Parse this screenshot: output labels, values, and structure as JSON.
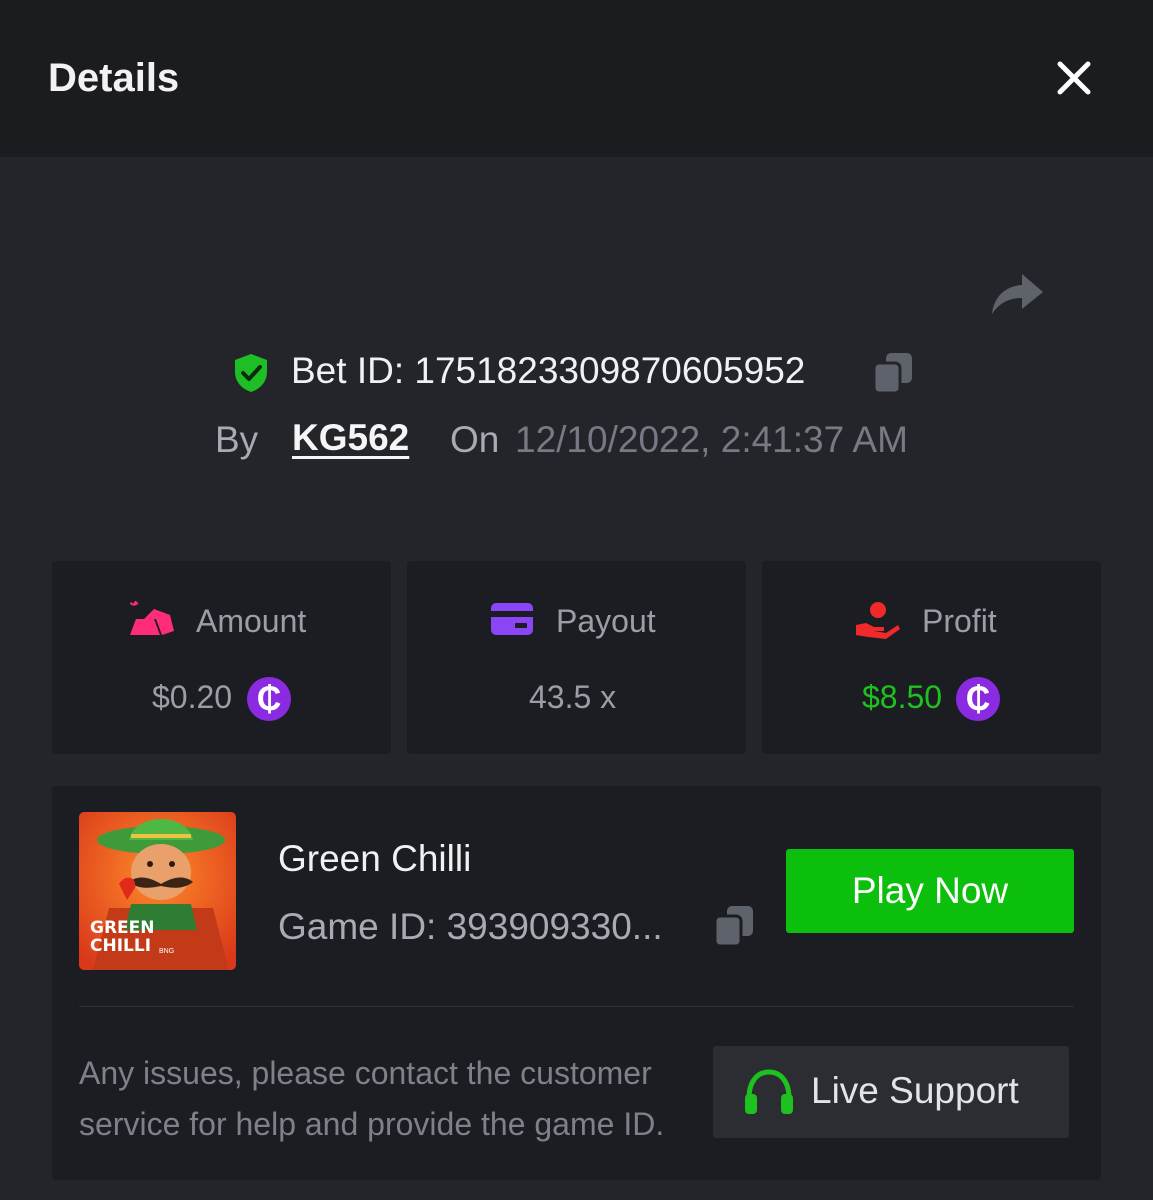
{
  "header": {
    "title": "Details"
  },
  "bet": {
    "id_label": "Bet ID: 1751823309870605952",
    "by_label": "By",
    "user": "KG562",
    "on_label": "On",
    "date": "12/10/2022, 2:41:37 AM"
  },
  "stats": {
    "amount": {
      "label": "Amount",
      "value": "$0.20",
      "coin_symbol": "₵"
    },
    "payout": {
      "label": "Payout",
      "value": "43.5 x"
    },
    "profit": {
      "label": "Profit",
      "value": "$8.50",
      "coin_symbol": "₵"
    }
  },
  "game": {
    "name": "Green Chilli",
    "id_label": "Game ID: 393909330...",
    "thumb_title_line1": "GREEN",
    "thumb_title_line2": "CHILLI",
    "thumb_brand": "BNG",
    "play_label": "Play Now",
    "note": "Any issues, please contact the customer service for help and provide the game ID.",
    "support_label": "Live Support"
  },
  "colors": {
    "background": "#24252a",
    "header_bg": "#1b1c20",
    "card_bg": "#1c1d22",
    "profit_green": "#1ec21e",
    "play_green": "#0bbf0c",
    "coin_purple": "#8a2be2",
    "amount_pink": "#ff2d78",
    "payout_purple": "#8b45f5",
    "profit_red": "#f02a2a"
  },
  "icons": {
    "close": "close-icon",
    "share": "share-icon",
    "verified": "shield-check-icon",
    "copy": "copy-icon",
    "amount": "gold-bars-icon",
    "payout": "card-icon",
    "profit": "hand-coin-icon",
    "support": "headphones-icon"
  }
}
